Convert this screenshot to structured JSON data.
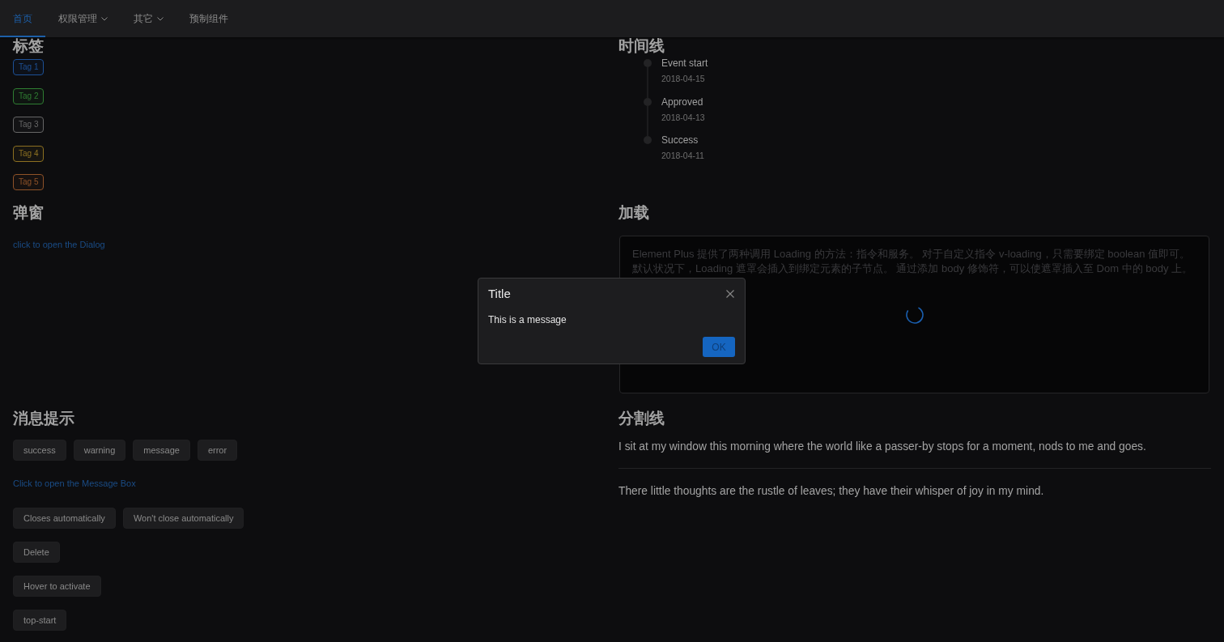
{
  "nav": {
    "items": [
      {
        "label": "首页",
        "selected": true,
        "dropdown": false
      },
      {
        "label": "权限管理",
        "selected": false,
        "dropdown": true
      },
      {
        "label": "其它",
        "selected": false,
        "dropdown": true
      },
      {
        "label": "预制组件",
        "selected": false,
        "dropdown": false
      }
    ]
  },
  "tags_section": {
    "title": "标签",
    "tags": [
      {
        "label": "Tag 1",
        "color": "#1d5096"
      },
      {
        "label": "Tag 2",
        "color": "#2f7d32"
      },
      {
        "label": "Tag 3",
        "color": "#666666"
      },
      {
        "label": "Tag 4",
        "color": "#8c7021"
      },
      {
        "label": "Tag 5",
        "color": "#8e5228"
      }
    ]
  },
  "timeline_section": {
    "title": "时间线",
    "events": [
      {
        "content": "Event start",
        "timestamp": "2018-04-15"
      },
      {
        "content": "Approved",
        "timestamp": "2018-04-13"
      },
      {
        "content": "Success",
        "timestamp": "2018-04-11"
      }
    ]
  },
  "dialog_section": {
    "title": "弹窗",
    "link": "click to open the Dialog"
  },
  "loading_section": {
    "title": "加载",
    "loading": true,
    "text": "Element Plus 提供了两种调用 Loading 的方法：指令和服务。 对于自定义指令 v-loading，只需要绑定 boolean 值即可。默认状况下，Loading 遮罩会插入到绑定元素的子节点。 通过添加 body 修饰符，可以使遮罩插入至 Dom 中的 body 上。"
  },
  "message_section": {
    "title": "消息提示",
    "type_buttons": [
      "success",
      "warning",
      "message",
      "error"
    ],
    "link": "Click to open the Message Box",
    "button_rows": [
      [
        "Closes automatically",
        "Won't close automatically"
      ],
      [
        "Delete"
      ],
      [
        "Hover to activate"
      ],
      [
        "top-start"
      ]
    ]
  },
  "divider_section": {
    "title": "分割线",
    "paragraphs": [
      "I sit at my window this morning where the world like a passer-by stops for a moment, nods to me and goes.",
      "There little thoughts are the rustle of leaves; they have their whisper of joy in my mind."
    ]
  },
  "dialog": {
    "title": "Title",
    "message": "This is a message",
    "buttons": [
      "OK"
    ]
  }
}
